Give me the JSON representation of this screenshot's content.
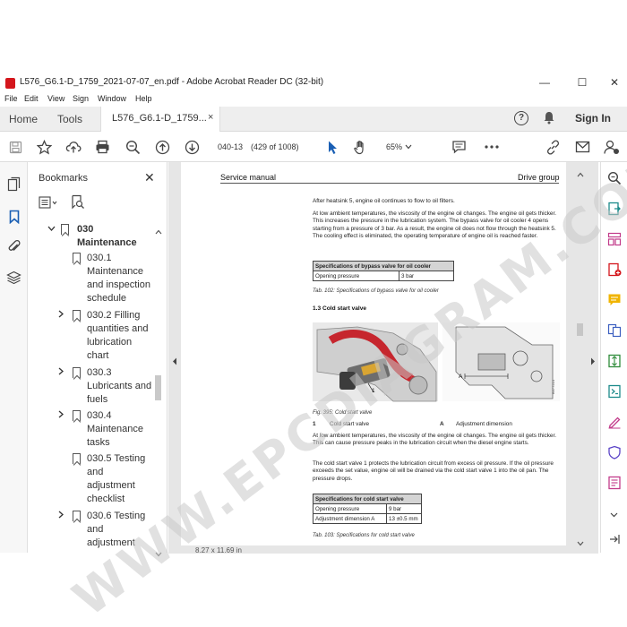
{
  "window": {
    "title": "L576_G6.1-D_1759_2021-07-07_en.pdf - Adobe Acrobat Reader DC (32-bit)",
    "minimize": "—",
    "maximize": "☐",
    "close": "✕"
  },
  "menu": [
    "File",
    "Edit",
    "View",
    "Sign",
    "Window",
    "Help"
  ],
  "tabs": {
    "home": "Home",
    "tools": "Tools",
    "document": "L576_G6.1-D_1759...",
    "close": "×",
    "sign_in": "Sign In",
    "help": "?"
  },
  "toolbar": {
    "page_number": "040-13",
    "page_count": "(429 of 1008)",
    "zoom": "65%"
  },
  "bookmarks": {
    "title": "Bookmarks",
    "close": "✕",
    "items": [
      {
        "label_line1": "030",
        "label_line2": "Maintenance",
        "expanded": true
      },
      {
        "label_line1": "030.1",
        "label_line2": "Maintenance",
        "label_line3": "and inspection",
        "label_line4": "schedule"
      },
      {
        "label_line1": "030.2 Filling",
        "label_line2": "quantities and",
        "label_line3": "lubrication",
        "label_line4": "chart"
      },
      {
        "label_line1": "030.3",
        "label_line2": "Lubricants and",
        "label_line3": "fuels"
      },
      {
        "label_line1": "030.4",
        "label_line2": "Maintenance",
        "label_line3": "tasks"
      },
      {
        "label_line1": "030.5 Testing",
        "label_line2": "and",
        "label_line3": "adjustment",
        "label_line4": "checklist"
      },
      {
        "label_line1": "030.6 Testing",
        "label_line2": "and",
        "label_line3": "adjustment"
      }
    ]
  },
  "document": {
    "header_left": "Service manual",
    "header_right": "Drive group",
    "p1": "After heatsink 5, engine oil continues to flow to oil filters.",
    "p2": "At low ambient temperatures, the viscosity of the engine oil changes. The engine oil gets thicker. This increases the pressure in the lubrication system. The bypass valve for oil cooler 4 opens starting from a pressure of 3 bar. As a result, the engine oil does not flow through the heatsink 5. The cooling effect is eliminated, the operating temperature of engine oil is reached faster.",
    "table1": {
      "header": "Specifications of bypass valve for oil cooler",
      "row_label": "Opening pressure",
      "row_value": "3 bar"
    },
    "caption1": "Tab. 102: Specifications of bypass valve for oil cooler",
    "section": "1.3 Cold start valve",
    "fig_callout_1": "1",
    "fig_callout_a": "A",
    "fig_caption": "Fig. 395: Cold start valve",
    "legend_1_num": "1",
    "legend_1_text": "Cold start valve",
    "legend_a_num": "A",
    "legend_a_text": "Adjustment dimension",
    "p3": "At low ambient temperatures, the viscosity of the engine oil changes. The engine oil gets thicker. This can cause pressure peaks in the lubrication circuit when the diesel engine starts.",
    "p4": "The cold start valve 1 protects the lubrication circuit from excess oil pressure. If the oil pressure exceeds the set value, engine oil will be drained via the cold start valve 1 into the oil pan. The pressure drops.",
    "table2": {
      "header": "Specifications for cold start valve",
      "row1_label": "Opening pressure",
      "row1_value": "9 bar",
      "row2_label": "Adjustment dimension A",
      "row2_value": "13 ±0.5 mm"
    },
    "caption2": "Tab. 103: Specifications for cold start valve"
  },
  "status": {
    "page_size": "8.27 x 11.69 in"
  },
  "watermark": "WWW.EPCDIAGRAM.COM"
}
